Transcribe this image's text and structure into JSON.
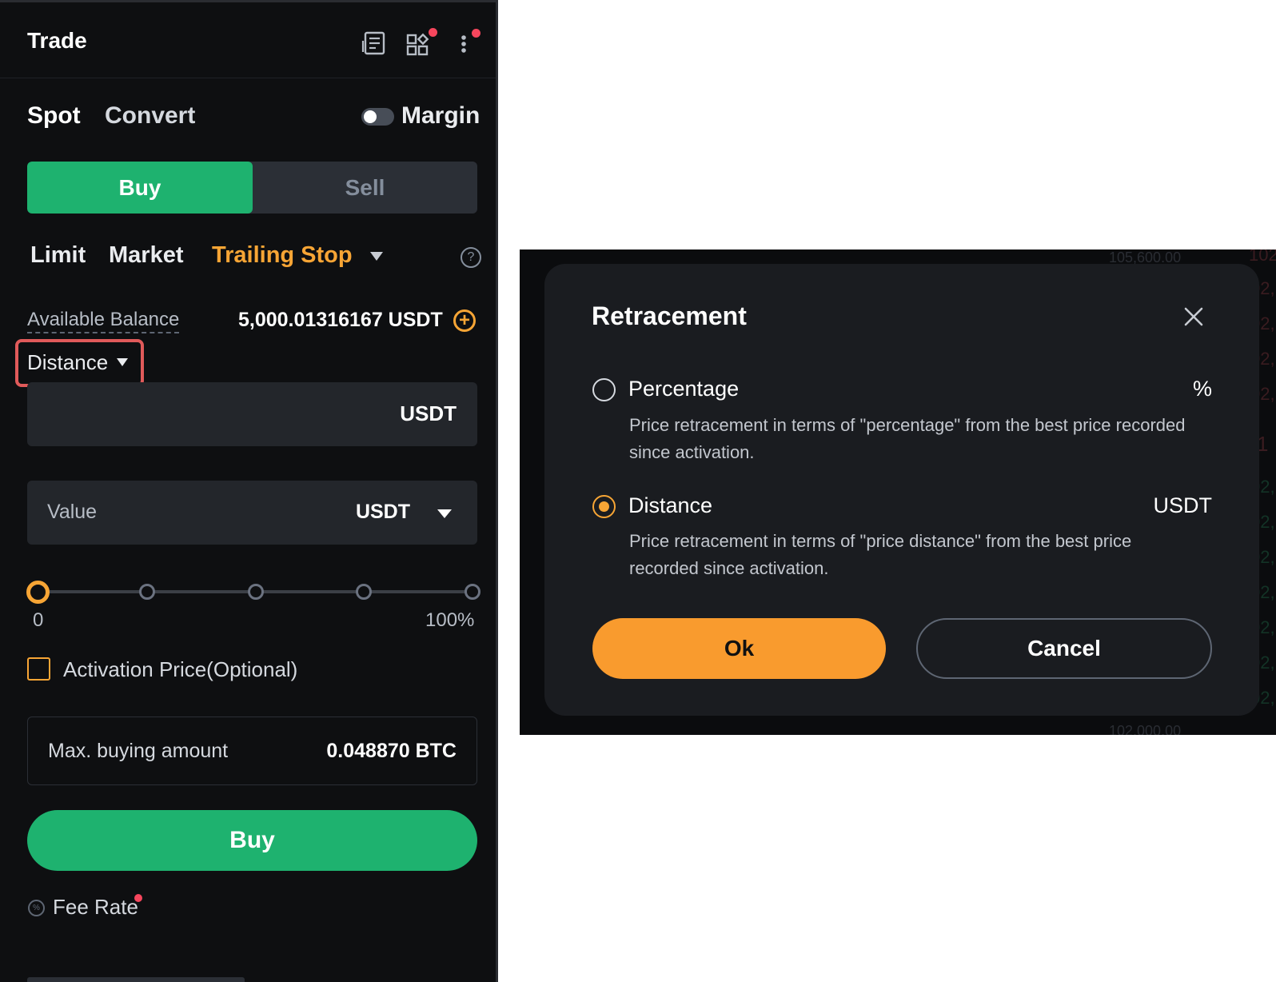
{
  "trade_panel": {
    "title": "Trade",
    "icons": {
      "orderbook": "orderbook-icon",
      "widgets": "widgets-icon",
      "more": "more-vertical-icon"
    },
    "mode_tabs": [
      {
        "label": "Spot",
        "active": true
      },
      {
        "label": "Convert",
        "active": false
      }
    ],
    "margin": {
      "label": "Margin",
      "enabled": false
    },
    "side": {
      "buy_label": "Buy",
      "sell_label": "Sell",
      "selected": "Buy"
    },
    "order_types": [
      {
        "label": "Limit",
        "active": false
      },
      {
        "label": "Market",
        "active": false
      },
      {
        "label": "Trailing Stop",
        "active": true
      }
    ],
    "available_balance": {
      "label": "Available Balance",
      "value": "5,000.01316167 USDT"
    },
    "retracement_select": {
      "label": "Distance"
    },
    "distance_input": {
      "value": "",
      "unit": "USDT"
    },
    "value_input": {
      "placeholder": "Value",
      "unit": "USDT"
    },
    "slider": {
      "min_label": "0",
      "max_label": "100%",
      "value_percent": 0,
      "stops": [
        0,
        25,
        50,
        75,
        100
      ]
    },
    "activation_price": {
      "label": "Activation Price(Optional)",
      "checked": false
    },
    "max_buying": {
      "label": "Max. buying amount",
      "value": "0.048870 BTC"
    },
    "submit_label": "Buy",
    "fee_rate_label": "Fee Rate"
  },
  "retracement_dialog": {
    "title": "Retracement",
    "options": [
      {
        "label": "Percentage",
        "unit": "%",
        "selected": false,
        "description": "Price retracement in terms of \"percentage\" from the best price recorded since activation."
      },
      {
        "label": "Distance",
        "unit": "USDT",
        "selected": true,
        "description": "Price retracement in terms of \"price distance\" from the best price recorded since activation."
      }
    ],
    "ok_label": "Ok",
    "cancel_label": "Cancel"
  },
  "background_chart": {
    "price_labels": [
      "105,600.00",
      "102,000.00"
    ],
    "edge_labels": [
      "102,",
      "02,",
      "02,",
      "02,",
      "02,",
      "1",
      "02,",
      "02,",
      "02,",
      "02,",
      "02,",
      "02,",
      "02,"
    ]
  },
  "colors": {
    "buy_green": "#1eb26f",
    "accent_orange": "#f7a535",
    "ok_orange": "#f99b2e",
    "alert_red": "#f6465d",
    "highlight_box": "#e05a5a",
    "panel_bg": "#0e0f11",
    "modal_bg": "#1a1c20"
  }
}
